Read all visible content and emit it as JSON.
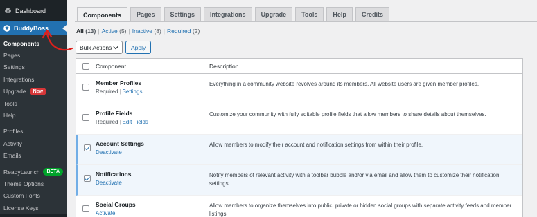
{
  "sidebar": {
    "dashboard": "Dashboard",
    "buddyboss": "BuddyBoss",
    "items": [
      {
        "label": "Components",
        "active": true
      },
      {
        "label": "Pages"
      },
      {
        "label": "Settings"
      },
      {
        "label": "Integrations"
      },
      {
        "label": "Upgrade",
        "badge": "New"
      },
      {
        "label": "Tools"
      },
      {
        "label": "Help"
      }
    ],
    "items2": [
      {
        "label": "Profiles"
      },
      {
        "label": "Activity"
      },
      {
        "label": "Emails"
      }
    ],
    "items3": [
      {
        "label": "ReadyLaunch",
        "badge": "BETA"
      },
      {
        "label": "Theme Options"
      },
      {
        "label": "Custom Fonts"
      },
      {
        "label": "License Keys"
      }
    ]
  },
  "tabs": [
    "Components",
    "Pages",
    "Settings",
    "Integrations",
    "Upgrade",
    "Tools",
    "Help",
    "Credits"
  ],
  "filters": {
    "all": "All",
    "all_count": "(13)",
    "active": "Active",
    "active_count": "(5)",
    "inactive": "Inactive",
    "inactive_count": "(8)",
    "required": "Required",
    "required_count": "(2)"
  },
  "bulk": {
    "label": "Bulk Actions",
    "apply": "Apply"
  },
  "table": {
    "col_component": "Component",
    "col_description": "Description",
    "rows": [
      {
        "name": "Member Profiles",
        "meta1": "Required",
        "meta2": "Settings",
        "desc": "Everything in a community website revolves around its members. All website users are given member profiles.",
        "checked": false,
        "active": false
      },
      {
        "name": "Profile Fields",
        "meta1": "Required",
        "meta2": "Edit Fields",
        "desc": "Customize your community with fully editable profile fields that allow members to share details about themselves.",
        "checked": false,
        "active": false
      },
      {
        "name": "Account Settings",
        "meta1": "Deactivate",
        "meta2": "",
        "desc": "Allow members to modify their account and notification settings from within their profile.",
        "checked": true,
        "active": true
      },
      {
        "name": "Notifications",
        "meta1": "Deactivate",
        "meta2": "",
        "desc": "Notify members of relevant activity with a toolbar bubble and/or via email and allow them to customize their notification settings.",
        "checked": true,
        "active": true
      },
      {
        "name": "Social Groups",
        "meta1": "Activate",
        "meta2": "",
        "desc": "Allow members to organize themselves into public, private or hidden social groups with separate activity feeds and member listings.",
        "checked": false,
        "active": false
      }
    ]
  },
  "colors": {
    "accent": "#2271b1",
    "sidebar": "#1d2327",
    "arrow": "#e0201b"
  }
}
